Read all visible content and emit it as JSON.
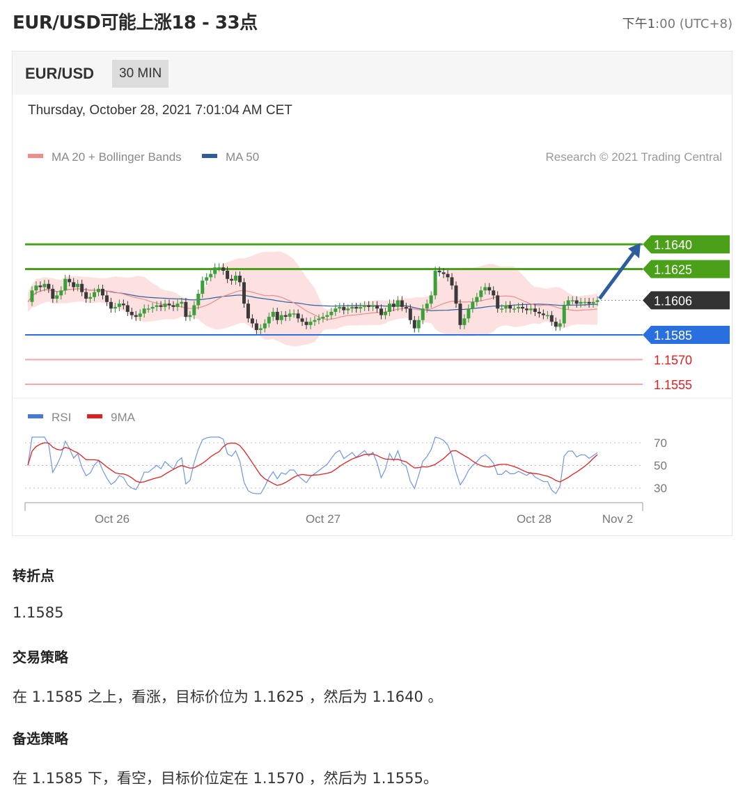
{
  "header": {
    "title": "EUR/USD可能上涨18 - 33点",
    "time_prefix": "下午1",
    "time_suffix": ":00 (UTC+8)"
  },
  "chart_card": {
    "symbol": "EUR/USD",
    "timeframe": "30 MIN",
    "timestamp": "Thursday, October 28, 2021 7:01:04 AM CET",
    "legend": [
      {
        "label": "MA 20 + Bollinger Bands",
        "color": "#f08c8c"
      },
      {
        "label": "MA 50",
        "color": "#2e5d9e"
      }
    ],
    "copyright": "Research © 2021 Trading Central",
    "rsi_legend": [
      {
        "label": "RSI",
        "color": "#4a78d8"
      },
      {
        "label": "9MA",
        "color": "#e02020"
      }
    ]
  },
  "chart_data": {
    "type": "candlestick",
    "instrument": "EUR/USD",
    "interval": "30 MIN",
    "price_levels": [
      {
        "label": "1.1640",
        "value": 1.164,
        "kind": "resistance",
        "color": "#4aa018"
      },
      {
        "label": "1.1625",
        "value": 1.1625,
        "kind": "resistance",
        "color": "#4aa018"
      },
      {
        "label": "1.1606",
        "value": 1.1606,
        "kind": "current",
        "color": "#333333"
      },
      {
        "label": "1.1585",
        "value": 1.1585,
        "kind": "pivot",
        "color": "#2a6fe0"
      },
      {
        "label": "1.1570",
        "value": 1.157,
        "kind": "support",
        "color": "#e02020"
      },
      {
        "label": "1.1555",
        "value": 1.1555,
        "kind": "support",
        "color": "#e02020"
      }
    ],
    "close_series": [
      1.1605,
      1.1612,
      1.1615,
      1.1614,
      1.1616,
      1.1613,
      1.1607,
      1.1609,
      1.1612,
      1.1619,
      1.1617,
      1.1614,
      1.1616,
      1.1611,
      1.1607,
      1.1608,
      1.1611,
      1.1613,
      1.1609,
      1.1605,
      1.1601,
      1.1602,
      1.1604,
      1.1603,
      1.1599,
      1.1597,
      1.1596,
      1.1598,
      1.1601,
      1.1601,
      1.1602,
      1.1603,
      1.1602,
      1.1604,
      1.1603,
      1.1602,
      1.1604,
      1.1605,
      1.1596,
      1.1597,
      1.1603,
      1.161,
      1.1618,
      1.162,
      1.1622,
      1.1626,
      1.1626,
      1.1624,
      1.1619,
      1.1618,
      1.1621,
      1.1617,
      1.1604,
      1.1595,
      1.1592,
      1.1588,
      1.1589,
      1.1592,
      1.1596,
      1.1599,
      1.1594,
      1.1597,
      1.1596,
      1.1598,
      1.1598,
      1.1595,
      1.1593,
      1.1591,
      1.1593,
      1.1594,
      1.1595,
      1.1596,
      1.1597,
      1.1599,
      1.1601,
      1.1602,
      1.16,
      1.1601,
      1.1602,
      1.1601,
      1.1602,
      1.1603,
      1.1602,
      1.1603,
      1.1601,
      1.1597,
      1.1599,
      1.1604,
      1.1602,
      1.1606,
      1.1602,
      1.1601,
      1.1594,
      1.1589,
      1.1594,
      1.1601,
      1.1604,
      1.1609,
      1.1624,
      1.1623,
      1.1622,
      1.162,
      1.1615,
      1.1604,
      1.1591,
      1.1595,
      1.1601,
      1.1605,
      1.1608,
      1.1612,
      1.1614,
      1.1612,
      1.1609,
      1.1601,
      1.1601,
      1.1603,
      1.1601,
      1.1601,
      1.1602,
      1.1601,
      1.16,
      1.1601,
      1.1599,
      1.1598,
      1.1597,
      1.1597,
      1.1593,
      1.159,
      1.1592,
      1.1603,
      1.1606,
      1.1606,
      1.1604,
      1.1605,
      1.1605,
      1.1604,
      1.1605,
      1.1606
    ],
    "rsi": {
      "levels": [
        70,
        50,
        30
      ],
      "ylim": [
        20,
        80
      ]
    },
    "x_ticks": [
      "Oct 26",
      "Oct 27",
      "Oct 28",
      "Nov 2"
    ]
  },
  "sections": {
    "pivot_heading": "转折点",
    "pivot_value": "1.1585",
    "strategy_heading": "交易策略",
    "strategy_text": "在 1.1585 之上，看涨，目标价位为 1.1625 ，然后为 1.1640 。",
    "alt_heading": "备选策略",
    "alt_text": "在 1.1585 下，看空，目标价位定在 1.1570 ，然后为 1.1555。"
  }
}
